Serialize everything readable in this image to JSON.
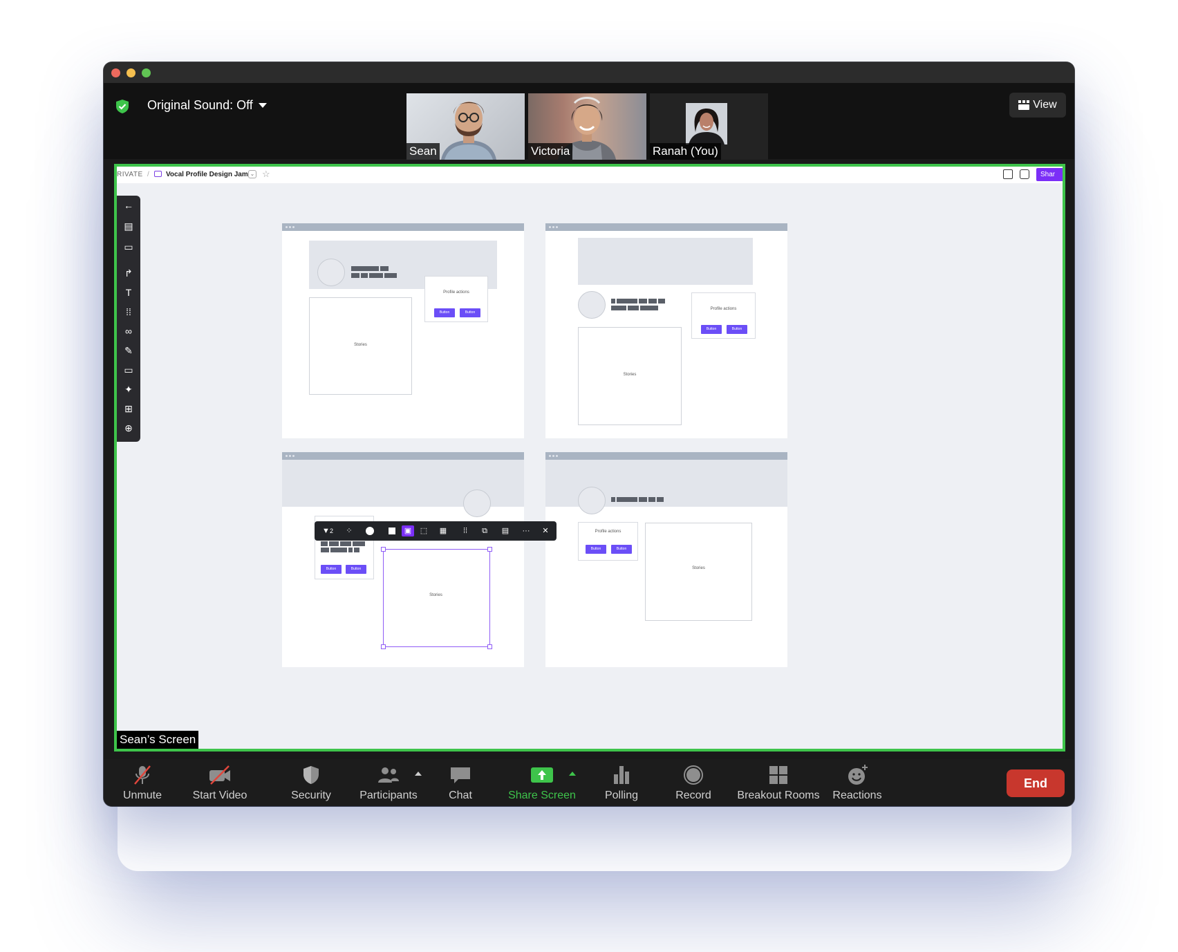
{
  "topbar": {
    "sound_label": "Original Sound: Off",
    "view_label": "View"
  },
  "participants": [
    {
      "name": "Sean"
    },
    {
      "name": "Victoria"
    },
    {
      "name": "Ranah (You)"
    }
  ],
  "shared_app": {
    "breadcrumb_private": "RIVATE",
    "board_title": "Vocal Profile Design Jam",
    "share_label": "Shar",
    "wireframes": {
      "profile_actions": "Profile actions",
      "button": "Button",
      "stories": "Stories"
    },
    "context_toolbar": {
      "filter_count": "2"
    }
  },
  "screen_label": "Sean’s Screen",
  "controls": {
    "unmute": "Unmute",
    "start_video": "Start Video",
    "security": "Security",
    "participants": "Participants",
    "chat": "Chat",
    "share_screen": "Share Screen",
    "polling": "Polling",
    "record": "Record",
    "breakout_rooms": "Breakout Rooms",
    "reactions": "Reactions",
    "end": "End"
  },
  "colors": {
    "share_border": "#3ec44b",
    "end_button": "#c8372d",
    "accent_purple": "#6b4ef7"
  }
}
